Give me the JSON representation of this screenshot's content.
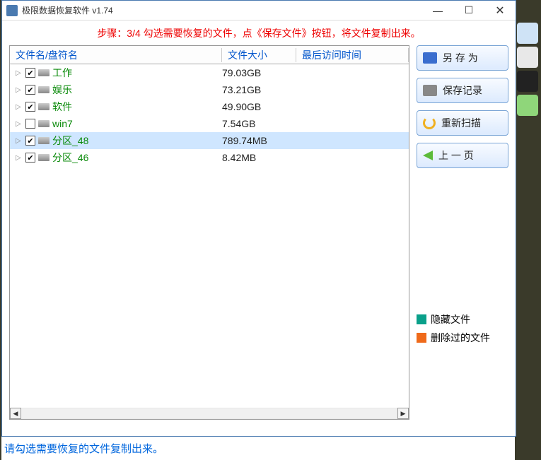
{
  "window": {
    "title": "极限数据恢复软件 v1.74"
  },
  "step_message": "步骤：3/4 勾选需要恢复的文件，点《保存文件》按钮，将文件复制出来。",
  "columns": {
    "name": "文件名/盘符名",
    "size": "文件大小",
    "access": "最后访问时间"
  },
  "rows": [
    {
      "checked": true,
      "name": "工作",
      "size": "79.03GB",
      "selected": false
    },
    {
      "checked": true,
      "name": "娱乐",
      "size": "73.21GB",
      "selected": false
    },
    {
      "checked": true,
      "name": "软件",
      "size": "49.90GB",
      "selected": false
    },
    {
      "checked": false,
      "name": "win7",
      "size": "7.54GB",
      "selected": false
    },
    {
      "checked": true,
      "name": "分区_48",
      "size": "789.74MB",
      "selected": true
    },
    {
      "checked": true,
      "name": "分区_46",
      "size": "8.42MB",
      "selected": false
    }
  ],
  "buttons": {
    "save": "另 存 为",
    "log": "保存记录",
    "rescan": "重新扫描",
    "back": "上 一 页"
  },
  "legend": {
    "hidden": {
      "label": "隐藏文件",
      "color": "#0aa08a"
    },
    "deleted": {
      "label": "删除过的文件",
      "color": "#ef6a1a"
    }
  },
  "status": "请勾选需要恢复的文件复制出来。"
}
